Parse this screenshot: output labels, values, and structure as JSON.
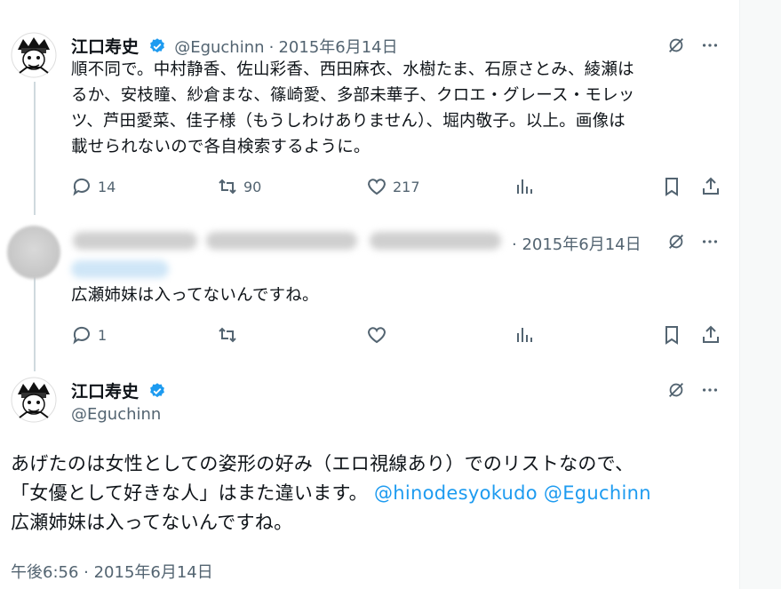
{
  "tweet1": {
    "name": "江口寿史",
    "handle": "@Eguchinn",
    "separator": "·",
    "date": "2015年6月14日",
    "lines": [
      "順不同で。中村静香、佐山彩香、西田麻衣、水樹たま、石原さとみ、綾瀬は",
      "るか、安枝瞳、紗倉まな、篠崎愛、多部未華子、クロエ・グレース・モレッ",
      "ツ、芦田愛菜、佳子様（もうしわけありません）、堀内敬子。以上。画像は",
      "載せられないので各自検索するように。"
    ],
    "replies": "14",
    "retweets": "90",
    "likes": "217"
  },
  "tweet2": {
    "date": "· 2015年6月14日",
    "text": "広瀬姉妹は入ってないんですね。",
    "replies": "1"
  },
  "tweet3": {
    "name": "江口寿史",
    "handle": "@Eguchinn",
    "line1": "あげたのは女性としての姿形の好み（エロ視線あり）でのリストなので、",
    "line2_prefix": "「女優として好きな人」はまた違います。",
    "mention1": "@hinodesyokudo",
    "mention2": "@Eguchinn",
    "line3": "広瀬姉妹は入ってないんですね。",
    "timestamp": "午後6:56 · 2015年6月14日"
  },
  "icons": [
    "verified-badge-icon",
    "grok-icon",
    "more-icon",
    "reply-icon",
    "retweet-icon",
    "like-icon",
    "views-icon",
    "bookmark-icon",
    "share-icon"
  ],
  "colors": {
    "accent": "#1d9bf0",
    "muted": "#536471",
    "thread_line": "#cfd9de"
  }
}
